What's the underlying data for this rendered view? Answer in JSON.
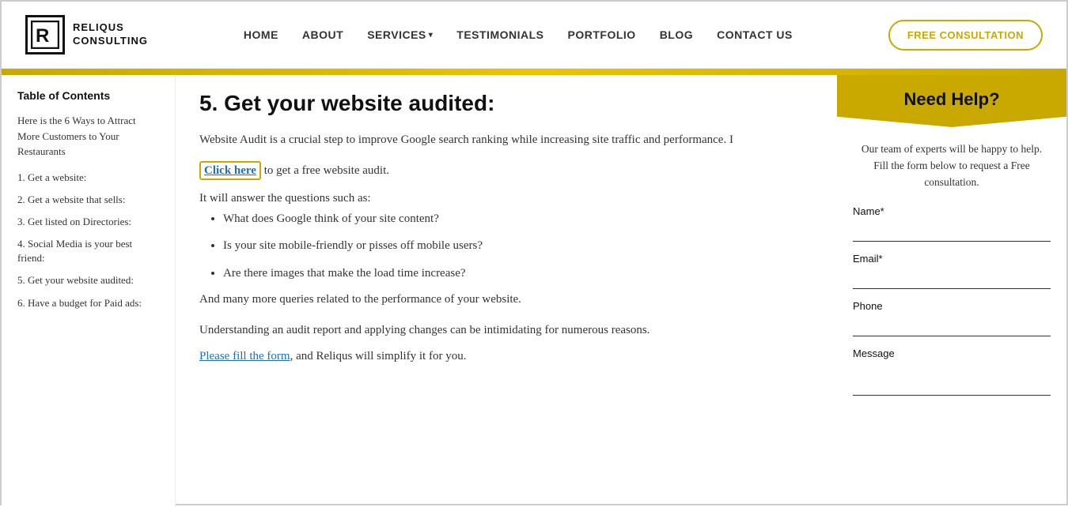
{
  "nav": {
    "logo_letter": "R",
    "logo_line1": "RELIQUS",
    "logo_line2": "CONSULTING",
    "links": [
      {
        "id": "home",
        "label": "HOME"
      },
      {
        "id": "about",
        "label": "ABOUT"
      },
      {
        "id": "services",
        "label": "SERVICES",
        "has_dropdown": true
      },
      {
        "id": "testimonials",
        "label": "TESTIMONIALS"
      },
      {
        "id": "portfolio",
        "label": "PORTFOLIO"
      },
      {
        "id": "blog",
        "label": "BLOG"
      },
      {
        "id": "contact",
        "label": "CONTACT US"
      }
    ],
    "cta_label": "FREE CONSULTATION"
  },
  "sidebar_toc": {
    "title": "Table of Contents",
    "intro": "Here is the 6 Ways to Attract More Customers to Your Restaurants",
    "items": [
      {
        "id": "toc-1",
        "label": "1. Get a website:"
      },
      {
        "id": "toc-2",
        "label": "2. Get a website that sells:"
      },
      {
        "id": "toc-3",
        "label": "3. Get listed on Directories:"
      },
      {
        "id": "toc-4",
        "label": "4. Social Media is your best friend:"
      },
      {
        "id": "toc-5",
        "label": "5. Get your website audited:"
      },
      {
        "id": "toc-6",
        "label": "6. Have a budget for Paid ads:"
      }
    ]
  },
  "article": {
    "heading": "5. Get your website audited:",
    "para1": "Website Audit is a crucial step to improve Google search ranking while increasing site traffic and performance. I",
    "click_here_label": "Click here",
    "click_here_suffix": " to get a free website audit.",
    "subtext": "It will answer the questions such as:",
    "bullets": [
      "What does Google think of your site content?",
      "Is your site mobile-friendly or pisses off mobile users?",
      "Are there images that make the load time increase?"
    ],
    "more_text": "And many more queries related to the performance of your website.",
    "understanding_line1": "Understanding an audit report and applying changes can be intimidating for numerous reasons.",
    "please_link": "Please fill the form",
    "please_suffix": ", and Reliqus will simplify it for you."
  },
  "form_panel": {
    "heading": "Need Help?",
    "description": "Our team of experts will be happy to help. Fill the form below to request a Free consultation.",
    "fields": [
      {
        "id": "name",
        "label": "Name*",
        "type": "text",
        "placeholder": ""
      },
      {
        "id": "email",
        "label": "Email*",
        "type": "email",
        "placeholder": ""
      },
      {
        "id": "phone",
        "label": "Phone",
        "type": "tel",
        "placeholder": ""
      },
      {
        "id": "message",
        "label": "Message",
        "type": "textarea",
        "placeholder": ""
      }
    ]
  }
}
